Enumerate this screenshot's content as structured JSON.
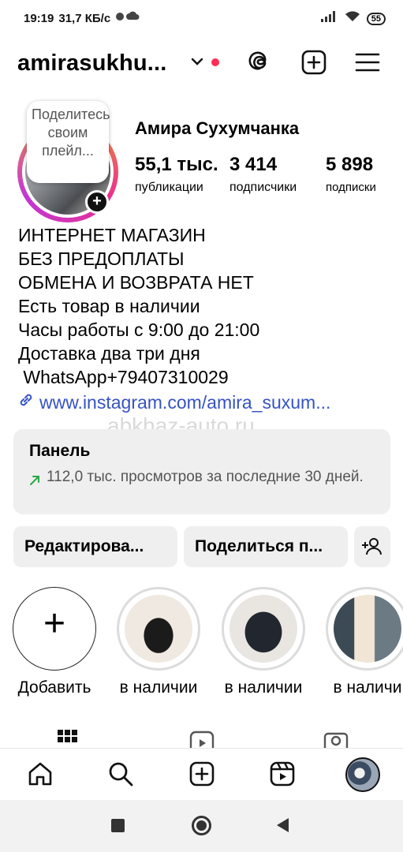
{
  "status_bar": {
    "time": "19:19",
    "network_speed": "31,7 КБ/с",
    "battery": "55"
  },
  "top_bar": {
    "username": "amirasukhu..."
  },
  "profile": {
    "name": "Амира Сухумчанка",
    "bubble_text": "Поделитесь своим плейл...",
    "stats": [
      {
        "value": "55,1 тыс.",
        "label": "публикации"
      },
      {
        "value": "3 414",
        "label": "подписчики"
      },
      {
        "value": "5 898",
        "label": "подписки"
      }
    ]
  },
  "bio": {
    "lines": [
      "ИНТЕРНЕТ МАГАЗИН",
      "БЕЗ ПРЕДОПЛАТЫ",
      "ОБМЕНА И ВОЗВРАТА НЕТ",
      "Есть товар в наличии",
      "Часы работы с 9:00 до 21:00",
      "Доставка два три дня",
      " WhatsApp+79407310029"
    ],
    "link": "www.instagram.com/amira_suxum..."
  },
  "watermark": "abkhaz-auto.ru",
  "dashboard": {
    "title": "Панель",
    "text": "112,0 тыс. просмотров за последние 30 дней."
  },
  "buttons": {
    "edit": "Редактирова...",
    "share": "Поделиться п..."
  },
  "highlights": [
    {
      "label": "Добавить"
    },
    {
      "label": "в наличии"
    },
    {
      "label": "в наличии"
    },
    {
      "label": "в наличи"
    }
  ],
  "colors": {
    "accent_red": "#ff2d55",
    "link_blue": "#3553c4",
    "growth_green": "#27a745",
    "panel_bg": "#efefef"
  }
}
